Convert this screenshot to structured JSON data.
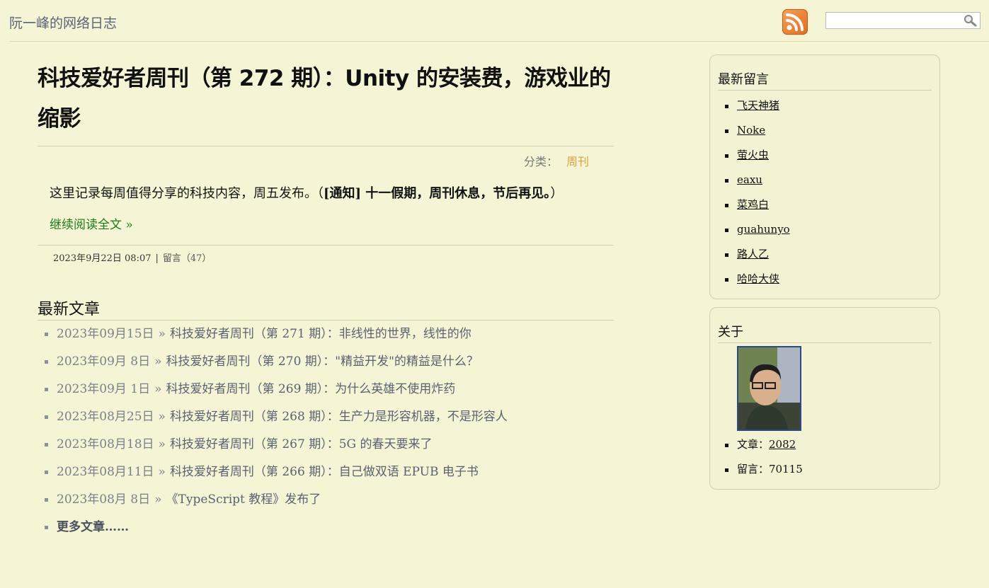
{
  "header": {
    "site_title": "阮一峰的网络日志",
    "rss_icon": "rss-feed-icon",
    "search_placeholder": "",
    "search_icon": "magnifier-icon"
  },
  "post": {
    "title": "科技爱好者周刊（第 272 期）：Unity 的安装费，游戏业的缩影",
    "category_label": "分类：",
    "category": "周刊",
    "summary_plain": "这里记录每周值得分享的科技内容，周五发布。（",
    "summary_bold": "[通知] 十一假期，周刊休息，节后再见。",
    "summary_end": "）",
    "read_more": "继续阅读全文 »",
    "date": "2023年9月22日 08:07",
    "separator": "|",
    "comments_link": "留言（47）"
  },
  "recent": {
    "heading": "最新文章",
    "items": [
      {
        "date": "2023年09月15日",
        "title": "科技爱好者周刊（第 271 期）：非线性的世界，线性的你"
      },
      {
        "date": "2023年09月 8日",
        "title": "科技爱好者周刊（第 270 期）：\"精益开发\"的精益是什么？"
      },
      {
        "date": "2023年09月 1日",
        "title": "科技爱好者周刊（第 269 期）：为什么英雄不使用炸药"
      },
      {
        "date": "2023年08月25日",
        "title": "科技爱好者周刊（第 268 期）：生产力是形容机器，不是形容人"
      },
      {
        "date": "2023年08月18日",
        "title": "科技爱好者周刊（第 267 期）：5G 的春天要来了"
      },
      {
        "date": "2023年08月11日",
        "title": "科技爱好者周刊（第 266 期）：自己做双语 EPUB 电子书"
      },
      {
        "date": "2023年08月 8日",
        "title": "《TypeScript 教程》发布了"
      }
    ],
    "arrow": "»",
    "more": "更多文章……"
  },
  "sidebar": {
    "comments_heading": "最新留言",
    "commenters": [
      "飞天神猪",
      "Noke",
      "萤火虫",
      "eaxu",
      "菜鸡白",
      "guahunyo",
      "路人乙",
      "哈哈大侠"
    ],
    "about_heading": "关于",
    "articles_label": "文章：",
    "articles_count": "2082",
    "comments_label": "留言：",
    "comments_count": "70115"
  },
  "colors": {
    "background": "#f5f5d5",
    "category": "#e0a040",
    "read_more": "#1a7a1a",
    "muted_link": "#5a6170"
  }
}
